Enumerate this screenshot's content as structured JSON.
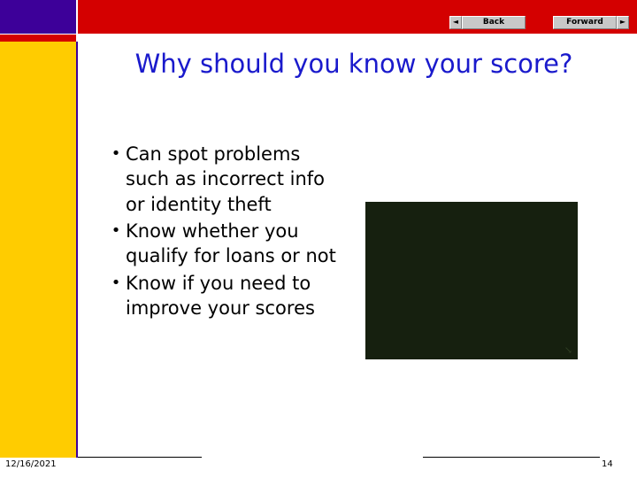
{
  "nav": {
    "back_label": "Back",
    "forward_label": "Forward",
    "back_arrow": "◄",
    "forward_arrow": "►"
  },
  "slide": {
    "title": "Why should you know your score?",
    "bullets": [
      "Can spot problems such as incorrect info or identity theft",
      "Know whether you qualify for loans or not",
      "Know if you need to improve your scores"
    ],
    "bullet_marker": "•",
    "image_watermark": "↘"
  },
  "footer": {
    "date": "12/16/2021",
    "page_number": "14"
  },
  "colors": {
    "title": "#1a1acc",
    "top_bar": "#d40000",
    "accent_purple": "#3d0099",
    "sidebar": "#ffcc00"
  }
}
